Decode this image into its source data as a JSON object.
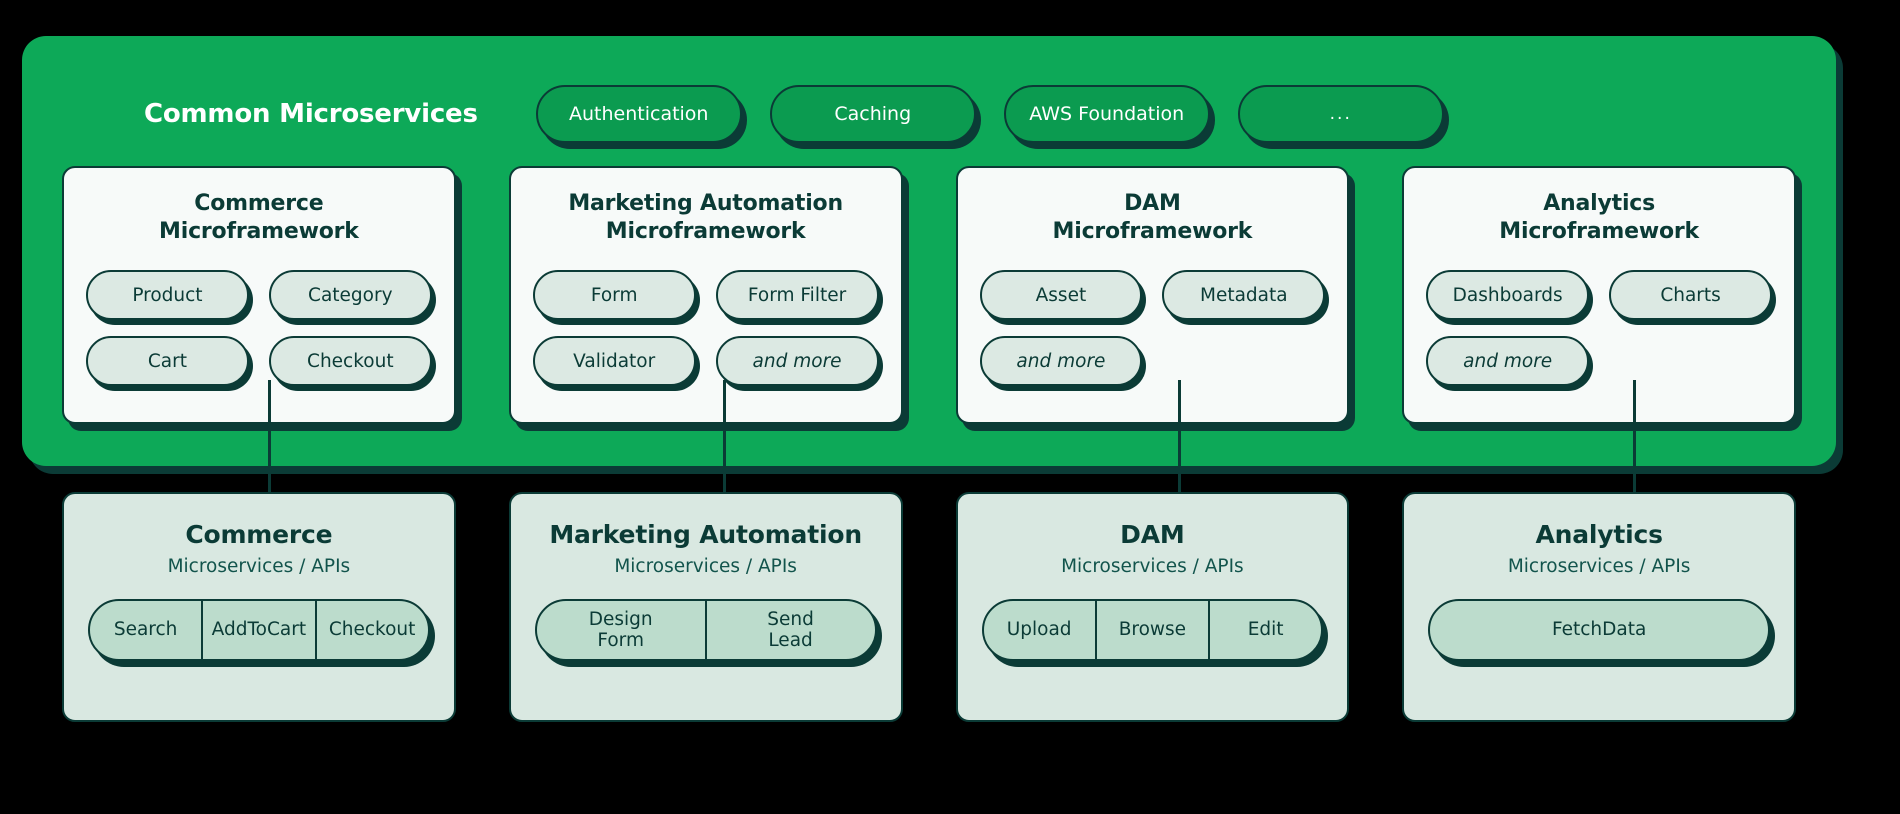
{
  "platform": {
    "title": "Common Microservices",
    "common_services": [
      {
        "label": "Authentication",
        "icon": "pill"
      },
      {
        "label": "Caching",
        "icon": "pill"
      },
      {
        "label": "AWS Foundation",
        "icon": "pill"
      },
      {
        "label": "...",
        "icon": "ellipsis"
      }
    ]
  },
  "frameworks": [
    {
      "title": "Commerce\nMicroframework",
      "pills": [
        {
          "label": "Product",
          "italic": false
        },
        {
          "label": "Category",
          "italic": false
        },
        {
          "label": "Cart",
          "italic": false
        },
        {
          "label": "Checkout",
          "italic": false
        }
      ]
    },
    {
      "title": "Marketing Automation\nMicroframework",
      "pills": [
        {
          "label": "Form",
          "italic": false
        },
        {
          "label": "Form Filter",
          "italic": false
        },
        {
          "label": "Validator",
          "italic": false
        },
        {
          "label": "and more",
          "italic": true
        }
      ]
    },
    {
      "title": "DAM\nMicroframework",
      "pills": [
        {
          "label": "Asset",
          "italic": false
        },
        {
          "label": "Metadata",
          "italic": false
        },
        {
          "label": "and more",
          "italic": true
        }
      ]
    },
    {
      "title": "Analytics\nMicroframework",
      "pills": [
        {
          "label": "Dashboards",
          "italic": false
        },
        {
          "label": "Charts",
          "italic": false
        },
        {
          "label": "and more",
          "italic": true
        }
      ]
    }
  ],
  "services": [
    {
      "title": "Commerce",
      "subtitle": "Microservices / APIs",
      "endpoints": [
        "Search",
        "AddToCart",
        "Checkout"
      ]
    },
    {
      "title": "Marketing Automation",
      "subtitle": "Microservices / APIs",
      "endpoints": [
        "Design\nForm",
        "Send\nLead"
      ]
    },
    {
      "title": "DAM",
      "subtitle": "Microservices / APIs",
      "endpoints": [
        "Upload",
        "Browse",
        "Edit"
      ]
    },
    {
      "title": "Analytics",
      "subtitle": "Microservices / APIs",
      "endpoints": [
        "FetchData"
      ]
    }
  ],
  "colors": {
    "background": "#000000",
    "platform_green": "#0DA958",
    "service_pill_green": "#0B9B50",
    "dark_teal": "#0B3B36",
    "card_white": "#F7FAF9",
    "framework_pill": "#DCE9E3",
    "service_card": "#D9E8E1",
    "segment_pill": "#BCDCCC"
  }
}
